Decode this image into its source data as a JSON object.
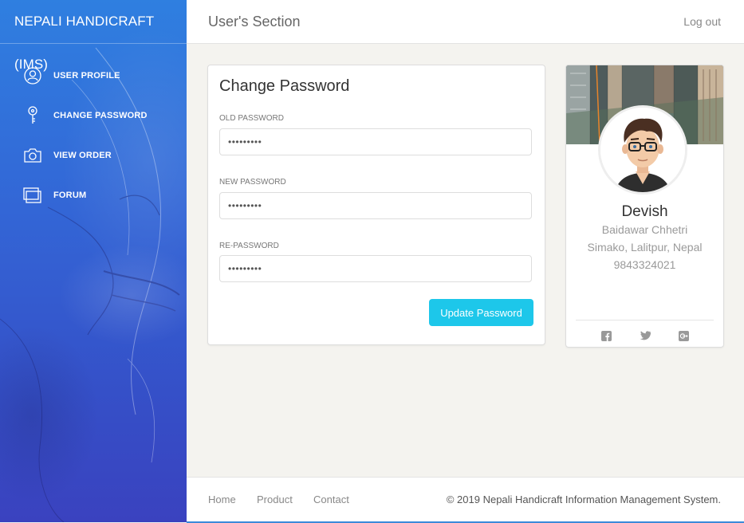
{
  "brand": "NEPALI HANDICRAFT (IMS)",
  "sidebar": {
    "items": [
      {
        "label": "USER PROFILE",
        "icon": "user-icon"
      },
      {
        "label": "CHANGE PASSWORD",
        "icon": "key-icon"
      },
      {
        "label": "VIEW ORDER",
        "icon": "camera-icon"
      },
      {
        "label": "FORUM",
        "icon": "windows-icon"
      }
    ]
  },
  "header": {
    "title": "User's Section",
    "logout": "Log out"
  },
  "password_form": {
    "title": "Change Password",
    "old_label": "OLD PASSWORD",
    "old_value": "•••••••••",
    "new_label": "NEW PASSWORD",
    "new_value": "•••••••••",
    "re_label": "RE-PASSWORD",
    "re_value": "•••••••••",
    "submit": "Update Password"
  },
  "profile": {
    "name": "Devish",
    "line1": "Baidawar Chhetri",
    "line2": "Simako, Lalitpur, Nepal",
    "phone": "9843324021",
    "socials": [
      "facebook-icon",
      "twitter-icon",
      "google-plus-icon"
    ]
  },
  "footer": {
    "links": [
      "Home",
      "Product",
      "Contact"
    ],
    "copyright": "© 2019 Nepali Handicraft Information Management System."
  },
  "colors": {
    "accent": "#1dc7ea",
    "sidebar_top": "#2f7fe0",
    "sidebar_bottom": "#3a42bf"
  }
}
